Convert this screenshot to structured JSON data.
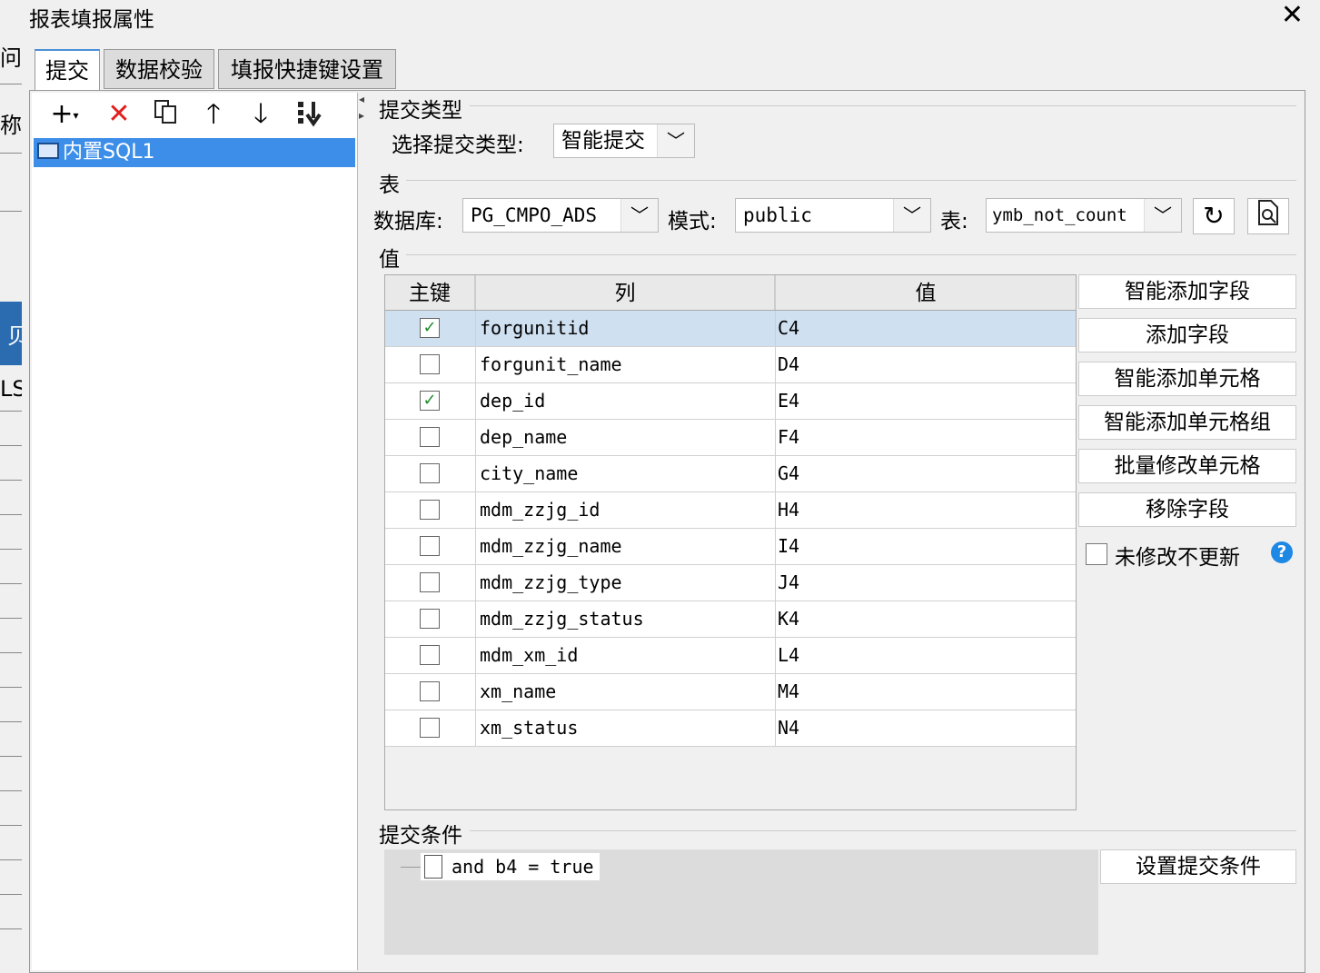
{
  "background_window": {
    "label_a": "问:",
    "label_b": "称:",
    "label_c": "贝",
    "label_d": "LS"
  },
  "dialog": {
    "title": "报表填报属性"
  },
  "tabs": [
    {
      "label": "提交"
    },
    {
      "label": "数据校验"
    },
    {
      "label": "填报快捷键设置"
    }
  ],
  "left_tree": {
    "items": [
      {
        "label": "内置SQL1"
      }
    ]
  },
  "toolbar": {
    "icons": [
      "add-icon",
      "delete-icon",
      "copy-icon",
      "move-up-icon",
      "move-down-icon",
      "move-bottom-icon"
    ]
  },
  "submit_type": {
    "section_label": "提交类型",
    "select_label": "选择提交类型:",
    "value": "智能提交"
  },
  "table_section": {
    "section_label": "表",
    "database_label": "数据库:",
    "database_value": "PG_CMPO_ADS",
    "schema_label": "模式:",
    "schema_value": "public",
    "table_label": "表:",
    "table_value": "ymb_not_count"
  },
  "values_section": {
    "section_label": "值",
    "columns": [
      "主键",
      "列",
      "值"
    ],
    "rows": [
      {
        "key": true,
        "column": "forgunitid",
        "value": "C4"
      },
      {
        "key": false,
        "column": "forgunit_name",
        "value": "D4"
      },
      {
        "key": true,
        "column": "dep_id",
        "value": "E4"
      },
      {
        "key": false,
        "column": "dep_name",
        "value": "F4"
      },
      {
        "key": false,
        "column": "city_name",
        "value": "G4"
      },
      {
        "key": false,
        "column": "mdm_zzjg_id",
        "value": "H4"
      },
      {
        "key": false,
        "column": "mdm_zzjg_name",
        "value": "I4"
      },
      {
        "key": false,
        "column": "mdm_zzjg_type",
        "value": "J4"
      },
      {
        "key": false,
        "column": "mdm_zzjg_status",
        "value": "K4"
      },
      {
        "key": false,
        "column": "mdm_xm_id",
        "value": "L4"
      },
      {
        "key": false,
        "column": "xm_name",
        "value": "M4"
      },
      {
        "key": false,
        "column": "xm_status",
        "value": "N4"
      }
    ],
    "buttons": [
      "智能添加字段",
      "添加字段",
      "智能添加单元格",
      "智能添加单元格组",
      "批量修改单元格",
      "移除字段"
    ],
    "no_update_unchanged": {
      "label": "未修改不更新",
      "checked": false
    }
  },
  "submit_condition": {
    "section_label": "提交条件",
    "condition": "and b4 = true",
    "button": "设置提交条件"
  },
  "colors": {
    "selection": "#3c8ee8",
    "row_selected": "#cfe0f1",
    "check": "#1e8c2e",
    "delete": "#e02020",
    "help": "#1e88e5"
  }
}
